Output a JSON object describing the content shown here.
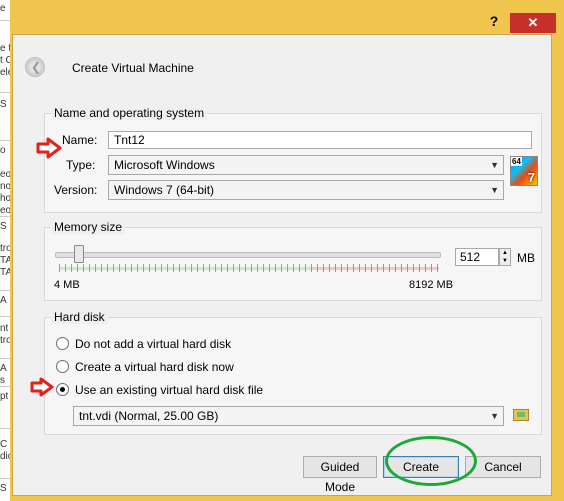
{
  "background_fragments": [
    "e",
    "e f",
    "t C",
    "ele",
    "S",
    "o",
    "eo",
    "no",
    "ho",
    "eo",
    "S",
    "tro",
    "TA",
    "TA",
    "A",
    "nt D",
    "tro",
    "A",
    "s",
    "pt",
    "C",
    "dic",
    "S"
  ],
  "window": {
    "help": "?",
    "close": "✕",
    "dialog_title": "Create Virtual Machine"
  },
  "name_os": {
    "group_label": "Name and operating system",
    "name_label": "Name:",
    "name_value": "Tnt12",
    "type_label": "Type:",
    "type_value": "Microsoft Windows",
    "version_label": "Version:",
    "version_value": "Windows 7 (64-bit)",
    "os_icon_badge": "64",
    "os_icon_num": "7"
  },
  "memory": {
    "group_label": "Memory size",
    "value": "512",
    "unit": "MB",
    "min_label": "4 MB",
    "max_label": "8192 MB",
    "slider_fraction": 0.062
  },
  "hard_disk": {
    "group_label": "Hard disk",
    "options": [
      {
        "label": "Do not add a virtual hard disk",
        "checked": false
      },
      {
        "label": "Create a virtual hard disk now",
        "checked": false
      },
      {
        "label": "Use an existing virtual hard disk file",
        "checked": true
      }
    ],
    "file_value": "tnt.vdi (Normal, 25.00 GB)"
  },
  "buttons": {
    "guided": "Guided Mode",
    "create": "Create",
    "cancel": "Cancel"
  },
  "colors": {
    "frame": "#f0c64e",
    "annotation_arrow": "#e2211c",
    "annotation_ellipse": "#1fa83a"
  }
}
